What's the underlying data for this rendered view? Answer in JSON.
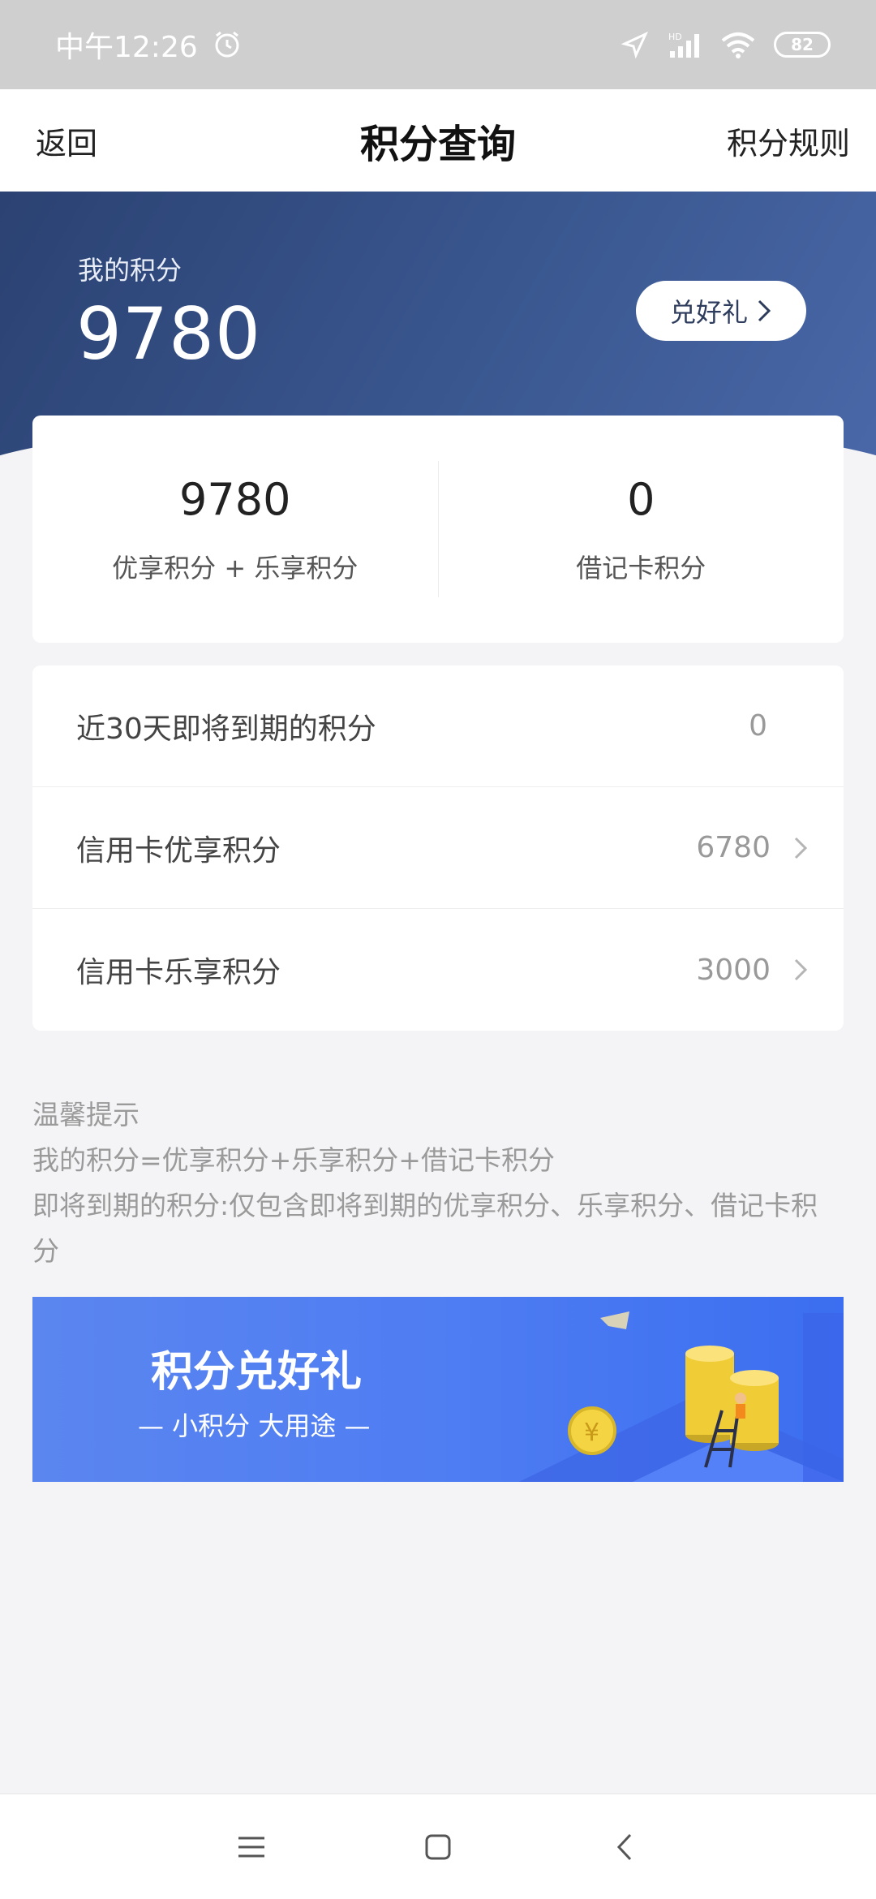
{
  "status_bar": {
    "time": "中午12:26",
    "battery": "82",
    "network_badge": "HD"
  },
  "nav": {
    "back_label": "返回",
    "title": "积分查询",
    "rules_label": "积分规则"
  },
  "header": {
    "my_points_label": "我的积分",
    "my_points_value": "9780",
    "redeem_label": "兑好礼"
  },
  "summary": {
    "left_value": "9780",
    "left_label": "优享积分 + 乐享积分",
    "right_value": "0",
    "right_label": "借记卡积分"
  },
  "list": [
    {
      "label": "近30天即将到期的积分",
      "value": "0"
    },
    {
      "label": "信用卡优享积分",
      "value": "6780"
    },
    {
      "label": "信用卡乐享积分",
      "value": "3000"
    }
  ],
  "tips": {
    "title": "温馨提示",
    "line1": "我的积分=优享积分+乐享积分+借记卡积分",
    "line2": "即将到期的积分:仅包含即将到期的优享积分、乐享积分、借记卡积分"
  },
  "promo": {
    "title": "积分兑好礼",
    "subtitle": "— 小积分 大用途 —",
    "coin_symbol": "¥"
  },
  "colors": {
    "header_gradient_start": "#2b4272",
    "header_gradient_end": "#4a68a8",
    "promo_blue": "#4f7df2",
    "page_bg": "#f4f4f6"
  },
  "icons": {
    "alarm": "alarm-icon",
    "signal": "signal-icon",
    "wifi": "wifi-icon",
    "chevron": "chevron-right-icon"
  }
}
